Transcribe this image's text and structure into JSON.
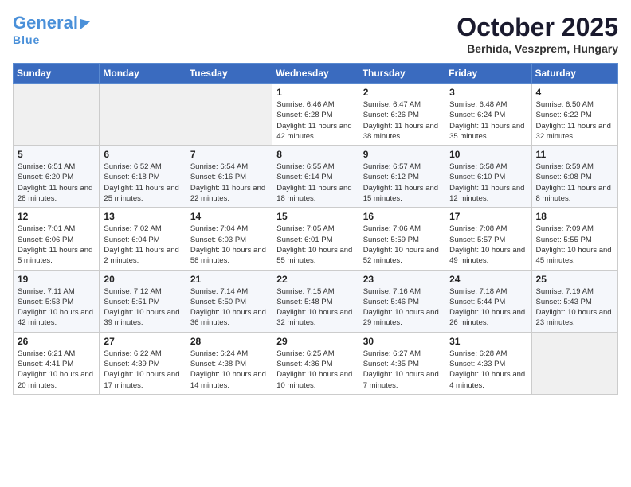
{
  "header": {
    "logo_general": "General",
    "logo_blue": "Blue",
    "month_title": "October 2025",
    "subtitle": "Berhida, Veszprem, Hungary"
  },
  "weekdays": [
    "Sunday",
    "Monday",
    "Tuesday",
    "Wednesday",
    "Thursday",
    "Friday",
    "Saturday"
  ],
  "weeks": [
    [
      {
        "day": "",
        "info": ""
      },
      {
        "day": "",
        "info": ""
      },
      {
        "day": "",
        "info": ""
      },
      {
        "day": "1",
        "info": "Sunrise: 6:46 AM\nSunset: 6:28 PM\nDaylight: 11 hours\nand 42 minutes."
      },
      {
        "day": "2",
        "info": "Sunrise: 6:47 AM\nSunset: 6:26 PM\nDaylight: 11 hours\nand 38 minutes."
      },
      {
        "day": "3",
        "info": "Sunrise: 6:48 AM\nSunset: 6:24 PM\nDaylight: 11 hours\nand 35 minutes."
      },
      {
        "day": "4",
        "info": "Sunrise: 6:50 AM\nSunset: 6:22 PM\nDaylight: 11 hours\nand 32 minutes."
      }
    ],
    [
      {
        "day": "5",
        "info": "Sunrise: 6:51 AM\nSunset: 6:20 PM\nDaylight: 11 hours\nand 28 minutes."
      },
      {
        "day": "6",
        "info": "Sunrise: 6:52 AM\nSunset: 6:18 PM\nDaylight: 11 hours\nand 25 minutes."
      },
      {
        "day": "7",
        "info": "Sunrise: 6:54 AM\nSunset: 6:16 PM\nDaylight: 11 hours\nand 22 minutes."
      },
      {
        "day": "8",
        "info": "Sunrise: 6:55 AM\nSunset: 6:14 PM\nDaylight: 11 hours\nand 18 minutes."
      },
      {
        "day": "9",
        "info": "Sunrise: 6:57 AM\nSunset: 6:12 PM\nDaylight: 11 hours\nand 15 minutes."
      },
      {
        "day": "10",
        "info": "Sunrise: 6:58 AM\nSunset: 6:10 PM\nDaylight: 11 hours\nand 12 minutes."
      },
      {
        "day": "11",
        "info": "Sunrise: 6:59 AM\nSunset: 6:08 PM\nDaylight: 11 hours\nand 8 minutes."
      }
    ],
    [
      {
        "day": "12",
        "info": "Sunrise: 7:01 AM\nSunset: 6:06 PM\nDaylight: 11 hours\nand 5 minutes."
      },
      {
        "day": "13",
        "info": "Sunrise: 7:02 AM\nSunset: 6:04 PM\nDaylight: 11 hours\nand 2 minutes."
      },
      {
        "day": "14",
        "info": "Sunrise: 7:04 AM\nSunset: 6:03 PM\nDaylight: 10 hours\nand 58 minutes."
      },
      {
        "day": "15",
        "info": "Sunrise: 7:05 AM\nSunset: 6:01 PM\nDaylight: 10 hours\nand 55 minutes."
      },
      {
        "day": "16",
        "info": "Sunrise: 7:06 AM\nSunset: 5:59 PM\nDaylight: 10 hours\nand 52 minutes."
      },
      {
        "day": "17",
        "info": "Sunrise: 7:08 AM\nSunset: 5:57 PM\nDaylight: 10 hours\nand 49 minutes."
      },
      {
        "day": "18",
        "info": "Sunrise: 7:09 AM\nSunset: 5:55 PM\nDaylight: 10 hours\nand 45 minutes."
      }
    ],
    [
      {
        "day": "19",
        "info": "Sunrise: 7:11 AM\nSunset: 5:53 PM\nDaylight: 10 hours\nand 42 minutes."
      },
      {
        "day": "20",
        "info": "Sunrise: 7:12 AM\nSunset: 5:51 PM\nDaylight: 10 hours\nand 39 minutes."
      },
      {
        "day": "21",
        "info": "Sunrise: 7:14 AM\nSunset: 5:50 PM\nDaylight: 10 hours\nand 36 minutes."
      },
      {
        "day": "22",
        "info": "Sunrise: 7:15 AM\nSunset: 5:48 PM\nDaylight: 10 hours\nand 32 minutes."
      },
      {
        "day": "23",
        "info": "Sunrise: 7:16 AM\nSunset: 5:46 PM\nDaylight: 10 hours\nand 29 minutes."
      },
      {
        "day": "24",
        "info": "Sunrise: 7:18 AM\nSunset: 5:44 PM\nDaylight: 10 hours\nand 26 minutes."
      },
      {
        "day": "25",
        "info": "Sunrise: 7:19 AM\nSunset: 5:43 PM\nDaylight: 10 hours\nand 23 minutes."
      }
    ],
    [
      {
        "day": "26",
        "info": "Sunrise: 6:21 AM\nSunset: 4:41 PM\nDaylight: 10 hours\nand 20 minutes."
      },
      {
        "day": "27",
        "info": "Sunrise: 6:22 AM\nSunset: 4:39 PM\nDaylight: 10 hours\nand 17 minutes."
      },
      {
        "day": "28",
        "info": "Sunrise: 6:24 AM\nSunset: 4:38 PM\nDaylight: 10 hours\nand 14 minutes."
      },
      {
        "day": "29",
        "info": "Sunrise: 6:25 AM\nSunset: 4:36 PM\nDaylight: 10 hours\nand 10 minutes."
      },
      {
        "day": "30",
        "info": "Sunrise: 6:27 AM\nSunset: 4:35 PM\nDaylight: 10 hours\nand 7 minutes."
      },
      {
        "day": "31",
        "info": "Sunrise: 6:28 AM\nSunset: 4:33 PM\nDaylight: 10 hours\nand 4 minutes."
      },
      {
        "day": "",
        "info": ""
      }
    ]
  ]
}
